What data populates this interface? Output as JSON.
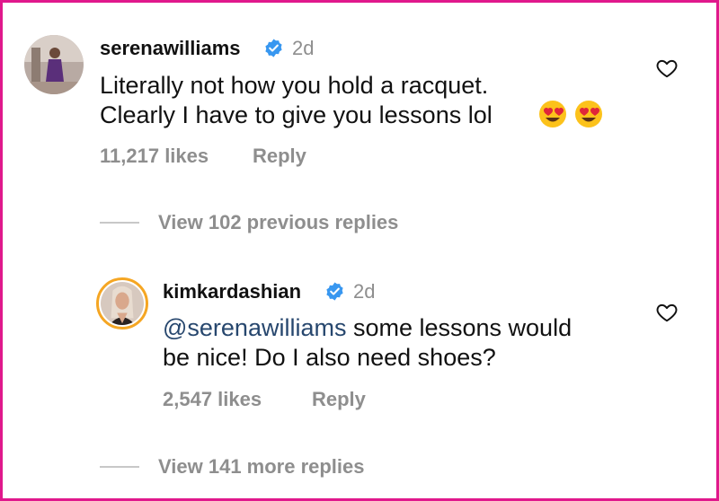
{
  "colors": {
    "border": "#e0188c",
    "muted": "#8e8e8e",
    "verified": "#3897f0",
    "mention": "#27476e",
    "story_ring": "#f5a623"
  },
  "comments": [
    {
      "username": "serenawilliams",
      "verified_icon": "verified-badge-icon",
      "time": "2d",
      "text_line1": "Literally not how you hold a racquet.",
      "text_line2": "Clearly I have to give you lessons lol",
      "emojis": [
        "heart-eyes-emoji",
        "heart-eyes-emoji"
      ],
      "likes": "11,217 likes",
      "reply_label": "Reply",
      "like_icon": "heart-outline-icon"
    },
    {
      "username": "kimkardashian",
      "verified_icon": "verified-badge-icon",
      "time": "2d",
      "mention": "@serenawilliams",
      "text_line1_rest": " some lessons would",
      "text_line2": "be nice! Do I also need shoes?",
      "likes": "2,547 likes",
      "reply_label": "Reply",
      "like_icon": "heart-outline-icon"
    }
  ],
  "thread": {
    "previous_replies": "View 102 previous replies",
    "more_replies": "View 141 more replies"
  }
}
